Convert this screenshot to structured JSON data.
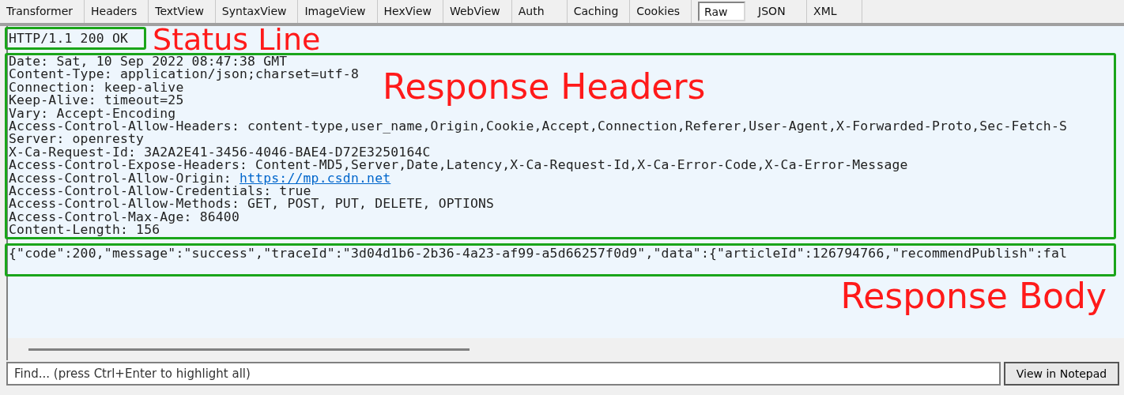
{
  "tabs": [
    {
      "label": "Transformer",
      "selected": false
    },
    {
      "label": "Headers",
      "selected": false
    },
    {
      "label": "TextView",
      "selected": false
    },
    {
      "label": "SyntaxView",
      "selected": false
    },
    {
      "label": "ImageView",
      "selected": false
    },
    {
      "label": "HexView",
      "selected": false
    },
    {
      "label": "WebView",
      "selected": false
    },
    {
      "label": "Auth",
      "selected": false
    },
    {
      "label": "Caching",
      "selected": false
    },
    {
      "label": "Cookies",
      "selected": false
    },
    {
      "label": "Raw",
      "selected": true
    },
    {
      "label": "JSON",
      "selected": false
    },
    {
      "label": "XML",
      "selected": false
    }
  ],
  "response": {
    "status_line": {
      "text": "HTTP/1.1 200 OK",
      "annotation": "Status Line"
    },
    "headers": {
      "annotation": "Response Headers",
      "lines": [
        {
          "text": "Date: Sat, 10 Sep 2022 08:47:38 GMT"
        },
        {
          "text": "Content-Type: application/json;charset=utf-8"
        },
        {
          "text": "Connection: keep-alive"
        },
        {
          "text": "Keep-Alive: timeout=25"
        },
        {
          "text": "Vary: Accept-Encoding"
        },
        {
          "text": "Access-Control-Allow-Headers: content-type,user_name,Origin,Cookie,Accept,Connection,Referer,User-Agent,X-Forwarded-Proto,Sec-Fetch-S"
        },
        {
          "text": "Server: openresty"
        },
        {
          "text": "X-Ca-Request-Id: 3A2A2E41-3456-4046-BAE4-D72E3250164C"
        },
        {
          "text": "Access-Control-Expose-Headers: Content-MD5,Server,Date,Latency,X-Ca-Request-Id,X-Ca-Error-Code,X-Ca-Error-Message"
        },
        {
          "text": "Access-Control-Allow-Origin: ",
          "link": "https://mp.csdn.net"
        },
        {
          "text": "Access-Control-Allow-Credentials: true"
        },
        {
          "text": "Access-Control-Allow-Methods: GET, POST, PUT, DELETE, OPTIONS"
        },
        {
          "text": "Access-Control-Max-Age: 86400"
        },
        {
          "text": "Content-Length: 156"
        }
      ]
    },
    "body": {
      "text": "{\"code\":200,\"message\":\"success\",\"traceId\":\"3d04d1b6-2b36-4a23-af99-a5d66257f0d9\",\"data\":{\"articleId\":126794766,\"recommendPublish\":fal",
      "annotation": "Response Body"
    }
  },
  "find": {
    "placeholder": "Find... (press Ctrl+Enter to highlight all)"
  },
  "notepad_button": {
    "label": "View in Notepad"
  }
}
